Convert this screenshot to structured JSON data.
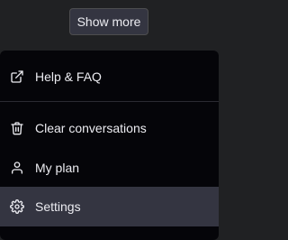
{
  "show_more": {
    "label": "Show more"
  },
  "menu": {
    "items": [
      {
        "label": "Help & FAQ",
        "icon": "external-link-icon"
      },
      {
        "label": "Clear conversations",
        "icon": "trash-icon"
      },
      {
        "label": "My plan",
        "icon": "user-icon"
      },
      {
        "label": "Settings",
        "icon": "gear-icon",
        "active": true
      }
    ]
  },
  "colors": {
    "background": "#202123",
    "menu_background": "#050509",
    "active_item": "#343541",
    "text": "#ececf1"
  }
}
